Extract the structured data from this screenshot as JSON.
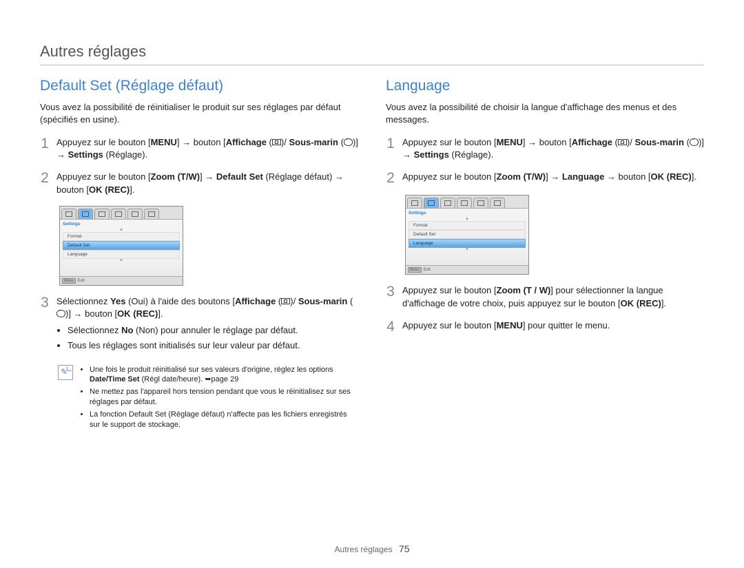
{
  "page_title": "Autres réglages",
  "footer_label": "Autres réglages",
  "page_number": "75",
  "left": {
    "heading": "Default Set (Réglage défaut)",
    "intro": "Vous avez la possibilité de réinitialiser le produit sur ses réglages par défaut (spécifiés en usine).",
    "steps": {
      "1": {
        "a": "Appuyez sur le bouton [",
        "menu": "MENU",
        "b": "] → bouton [",
        "aff": "Affichage",
        "c": " (",
        "d": ")/",
        "sous": "Sous-marin",
        "e": " (",
        "f": ")] → ",
        "settings": "Settings",
        "g": " (Réglage)."
      },
      "2": {
        "a": "Appuyez sur le bouton [",
        "zoom": "Zoom (T/W)",
        "b": "] → ",
        "def": "Default Set",
        "c": " (Réglage défaut) → bouton [",
        "ok": "OK (REC)",
        "d": "]."
      },
      "3": {
        "a": "Sélectionnez ",
        "yes": "Yes",
        "b": " (Oui) à l'aide des boutons [",
        "aff": "Affichage",
        "c": " (",
        "d": ")/",
        "sous": "Sous-marin",
        "e": " (",
        "f": ")] → bouton [",
        "ok": "OK (REC)",
        "g": "].",
        "sub1a": "Sélectionnez ",
        "sub1no": "No",
        "sub1b": " (Non) pour annuler le réglage par défaut.",
        "sub2": "Tous les réglages sont initialisés sur leur valeur par défaut."
      }
    },
    "screenshot": {
      "settings_label": "Settings",
      "items": [
        "Format",
        "Default Set",
        "Language"
      ],
      "selected_index": 1,
      "menu_btn": "Menu",
      "exit": "Exit"
    },
    "notes": {
      "n1a": "Une fois le produit réinitialisé sur ses valeurs d'origine, réglez les options ",
      "n1b": "Date/Time Set",
      "n1c": " (Régl date/heure). ➥page 29",
      "n2": "Ne mettez pas l'appareil hors tension pendant que vous le réinitialisez sur ses réglages par défaut.",
      "n3": "La fonction Default Set (Réglage défaut) n'affecte pas les fichiers enregistrés sur le support de stockage."
    }
  },
  "right": {
    "heading": "Language",
    "intro": "Vous avez la possibilité de choisir la langue d'affichage des menus et des messages.",
    "steps": {
      "1": {
        "a": "Appuyez sur le bouton [",
        "menu": "MENU",
        "b": "] → bouton [",
        "aff": "Affichage",
        "c": " (",
        "d": ")/",
        "sous": "Sous-marin",
        "e": " (",
        "f": ")] → ",
        "settings": "Settings",
        "g": " (Réglage)."
      },
      "2": {
        "a": "Appuyez sur le bouton [",
        "zoom": "Zoom (T/W)",
        "b": "] → ",
        "lang": "Language",
        "c": " → bouton [",
        "ok": "OK (REC)",
        "d": "]."
      },
      "3": {
        "a": "Appuyez sur le bouton [",
        "zoom": "Zoom (T / W)",
        "b": "] pour sélectionner la langue d'affichage de votre choix, puis appuyez sur le bouton [",
        "ok": "OK (REC)",
        "c": "]."
      },
      "4": {
        "a": "Appuyez sur le bouton [",
        "menu": "MENU",
        "b": "] pour quitter le menu."
      }
    },
    "screenshot": {
      "settings_label": "Settings",
      "items": [
        "Format",
        "Default Set",
        "Language"
      ],
      "selected_index": 2,
      "menu_btn": "Menu",
      "exit": "Exit"
    }
  }
}
